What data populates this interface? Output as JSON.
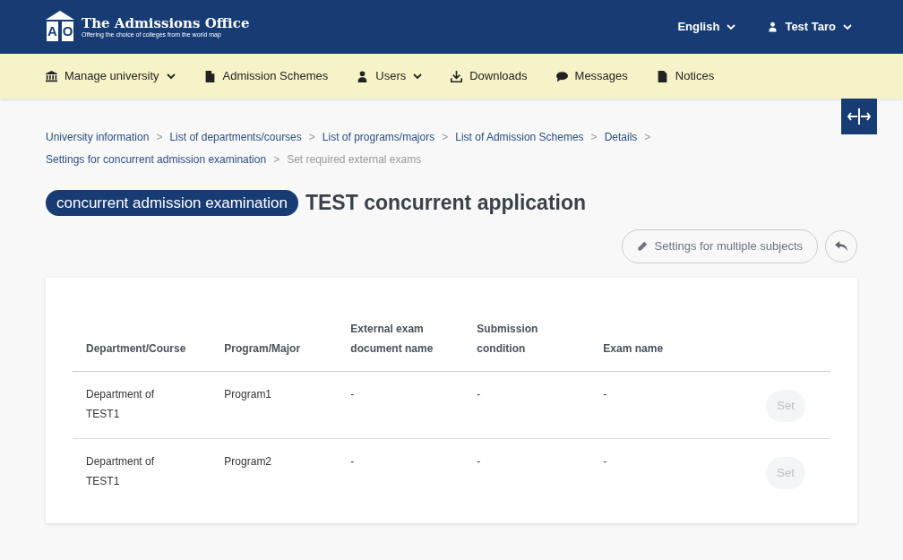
{
  "logo": {
    "mark_letters": [
      "A",
      "O"
    ],
    "title": "The Admissions Office",
    "tagline": "Offering the choice of colleges from the world map"
  },
  "header_menus": [
    {
      "label": "English",
      "kind": "language"
    },
    {
      "label": "Test Taro",
      "kind": "user"
    }
  ],
  "nav": [
    {
      "label": "Manage university",
      "kind": "bank",
      "dropdown": true
    },
    {
      "label": "Admission Schemes",
      "kind": "file",
      "dropdown": false
    },
    {
      "label": "Users",
      "kind": "user",
      "dropdown": true
    },
    {
      "label": "Downloads",
      "kind": "download",
      "dropdown": false
    },
    {
      "label": "Messages",
      "kind": "chat",
      "dropdown": false
    },
    {
      "label": "Notices",
      "kind": "doc",
      "dropdown": false
    }
  ],
  "breadcrumb": [
    {
      "label": "University information",
      "current": false
    },
    {
      "separator": ">",
      "label": "List of departments/courses",
      "current": false
    },
    {
      "separator": ">",
      "label": "List of programs/majors",
      "current": false
    },
    {
      "separator": ">",
      "label": "List of Admission Schemes",
      "current": false
    },
    {
      "separator": ">",
      "label": "Details",
      "current": false
    },
    {
      "separator": ">",
      "label": "Settings for concurrent admission examination",
      "current": false
    },
    {
      "separator": ">",
      "label": "Set required external exams",
      "current": true
    }
  ],
  "page": {
    "badge": "concurrent admission examination",
    "title": "TEST concurrent application"
  },
  "actions": {
    "multiple_subjects": "Settings for multiple subjects"
  },
  "table": {
    "columns": [
      "Department/Course",
      "Program/Major",
      "External exam document name",
      "Submission condition",
      "Exam name"
    ],
    "rows": [
      {
        "cells": [
          "Department of TEST1",
          "Program1",
          "-",
          "-",
          "-"
        ],
        "button": "Set",
        "disabled": true
      },
      {
        "cells": [
          "Department of TEST1",
          "Program2",
          "-",
          "-",
          "-"
        ],
        "button": "Set",
        "disabled": true
      }
    ]
  }
}
